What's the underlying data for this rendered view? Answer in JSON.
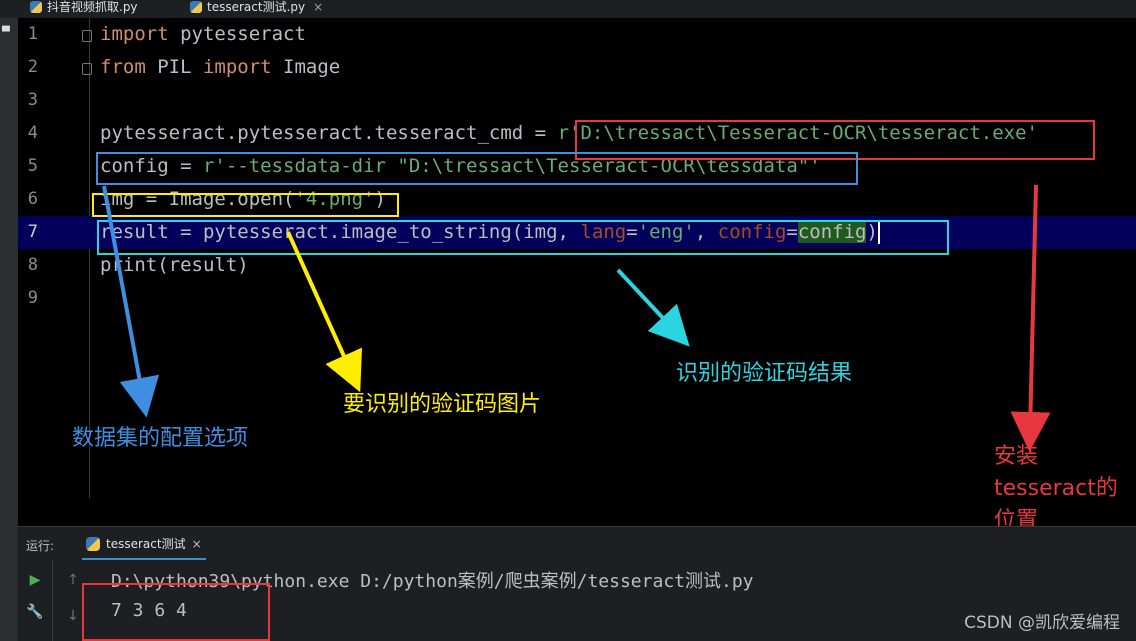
{
  "tabs": [
    {
      "label": "抖音视频抓取.py",
      "active": false
    },
    {
      "label": "tesseract测试.py",
      "active": true
    }
  ],
  "editor": {
    "line_numbers": [
      "1",
      "2",
      "3",
      "4",
      "5",
      "6",
      "7",
      "8",
      "9"
    ],
    "current_line": 7,
    "lines": [
      {
        "segments": [
          [
            "kw",
            "import"
          ],
          [
            "plain",
            " pytesseract"
          ]
        ]
      },
      {
        "segments": [
          [
            "kw",
            "from"
          ],
          [
            "plain",
            " PIL "
          ],
          [
            "kw",
            "import"
          ],
          [
            "plain",
            " Image"
          ]
        ]
      },
      {
        "segments": []
      },
      {
        "segments": [
          [
            "plain",
            "pytesseract.pytesseract.tesseract_cmd = "
          ],
          [
            "str",
            "r'D:\\tressact\\Tesseract-OCR\\tesseract.exe'"
          ]
        ]
      },
      {
        "segments": [
          [
            "plain",
            "config = "
          ],
          [
            "str",
            "r'--tessdata-dir \"D:\\tressact\\Tesseract-OCR\\tessdata\"'"
          ]
        ]
      },
      {
        "segments": [
          [
            "plain",
            "img = Image.open("
          ],
          [
            "str",
            "'4.png'"
          ],
          [
            "plain",
            ")"
          ]
        ]
      },
      {
        "segments": [
          [
            "plain",
            "result = pytesseract.image_to_string(img, "
          ],
          [
            "param",
            "lang"
          ],
          [
            "plain",
            "="
          ],
          [
            "str",
            "'eng'"
          ],
          [
            "plain",
            ", "
          ],
          [
            "param",
            "config"
          ],
          [
            "plain",
            "="
          ],
          [
            "hl",
            "config"
          ],
          [
            "plain",
            ")"
          ]
        ]
      },
      {
        "segments": [
          [
            "plain",
            "print(result)"
          ]
        ]
      },
      {
        "segments": []
      }
    ]
  },
  "annotations": {
    "config_dataset": "数据集的配置选项",
    "image_to_recognize": "要识别的验证码图片",
    "recognition_result": "识别的验证码结果",
    "install_location": "安装\ntesseract的\n位置"
  },
  "colors": {
    "red": "#e8383d",
    "blue": "#3f8fe0",
    "yellow": "#ffee00",
    "cyan": "#2ad4e0"
  },
  "run_panel": {
    "label": "运行:",
    "tab_label": "tesseract测试",
    "close": "×",
    "command": "D:\\python39\\python.exe D:/python案例/爬虫案例/tesseract测试.py",
    "output": "7 3 6 4"
  },
  "watermark": "CSDN @凯欣爱编程",
  "icons": {
    "run": "play-icon",
    "wrench": "wrench-icon",
    "up": "arrow-up-icon",
    "down": "arrow-down-icon"
  }
}
